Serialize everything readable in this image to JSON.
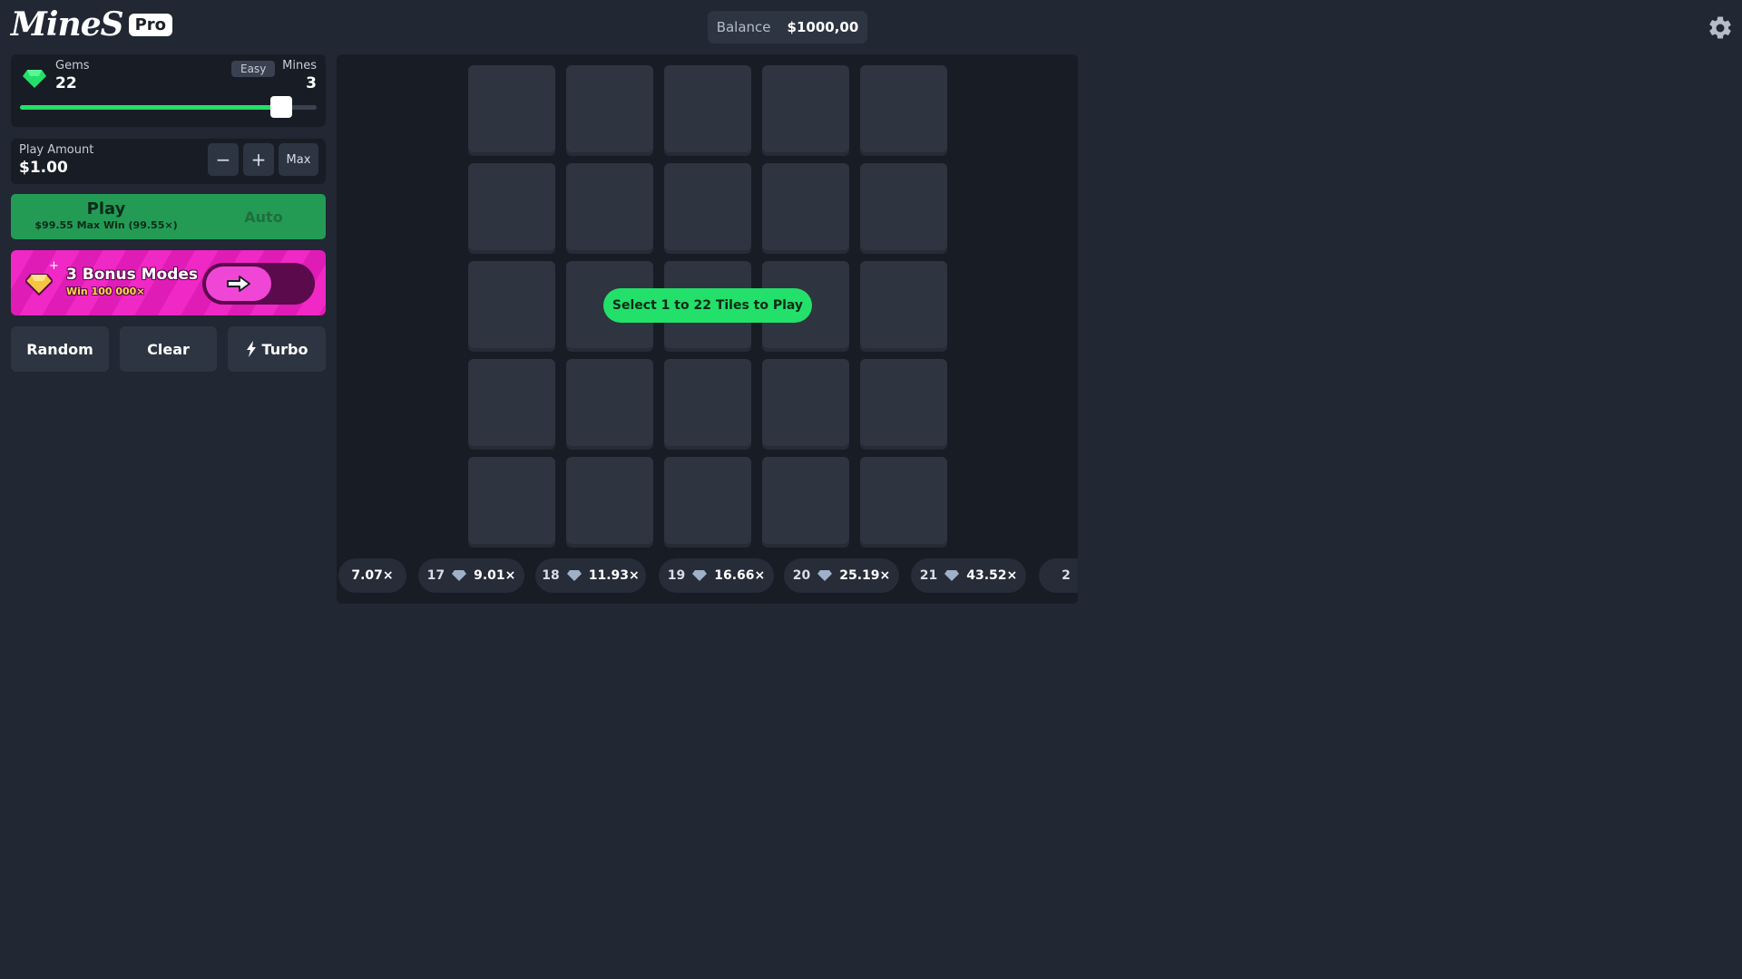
{
  "header": {
    "logo_text": "MineS",
    "logo_badge": "Pro",
    "balance_label": "Balance",
    "balance_value": "$1000,00",
    "settings_icon": "gear-icon"
  },
  "gems_panel": {
    "gems_label": "Gems",
    "gems_value": "22",
    "difficulty": "Easy",
    "mines_label": "Mines",
    "mines_value": "3",
    "slider_fraction": 0.88
  },
  "amount_panel": {
    "label": "Play Amount",
    "value": "$1.00",
    "minus": "−",
    "plus": "+",
    "max": "Max"
  },
  "play_panel": {
    "play_label": "Play",
    "play_subtitle": "$99.55 Max Win (99.55×)",
    "auto_label": "Auto"
  },
  "bonus_banner": {
    "title": "3 Bonus Modes",
    "subtitle": "Win 100 000×",
    "spark": "+"
  },
  "actions": {
    "random": "Random",
    "clear": "Clear",
    "turbo": "Turbo"
  },
  "board": {
    "rows": 5,
    "cols": 5,
    "hint": "Select 1 to 22 Tiles to Play"
  },
  "multipliers": [
    {
      "count": "",
      "value": "7.07×"
    },
    {
      "count": "17",
      "value": "9.01×"
    },
    {
      "count": "18",
      "value": "11.93×"
    },
    {
      "count": "19",
      "value": "16.66×"
    },
    {
      "count": "20",
      "value": "25.19×"
    },
    {
      "count": "21",
      "value": "43.52×"
    },
    {
      "count": "2",
      "value": ""
    }
  ],
  "colors": {
    "background": "#212733",
    "panel": "#181c24",
    "accent_green": "#23e06a",
    "play_green": "#239b55",
    "bonus_pink": "#f028c6"
  }
}
